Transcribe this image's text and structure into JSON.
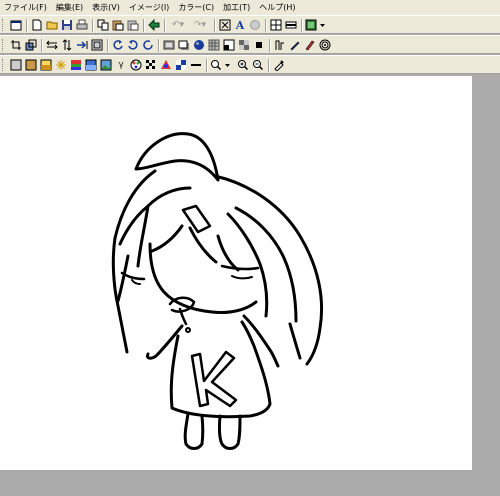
{
  "menu": {
    "items": [
      "ファイル(F)",
      "編集(E)",
      "表示(V)",
      "イメージ(I)",
      "カラー(C)",
      "加工(T)",
      "ヘルプ(H)"
    ]
  },
  "toolbar1": {
    "icons": [
      "new-window-icon",
      "new-file-icon",
      "open-folder-icon",
      "save-icon",
      "print-icon",
      "copy-icon",
      "paste-icon",
      "paste-new-icon",
      "capture-icon",
      "undo-icon",
      "redo-icon",
      "fit-icon",
      "text-icon",
      "circle-icon",
      "grid-icon",
      "ruler-icon",
      "color-select-icon"
    ]
  },
  "toolbar2": {
    "icons": [
      "crop-icon",
      "resize-icon",
      "flip-vertical-icon",
      "flip-horizontal-icon",
      "arrow-right-icon",
      "frame-icon",
      "rotate-left-icon",
      "rotate-right-icon",
      "rotate-icon",
      "emboss-icon",
      "shadow-icon",
      "sphere-icon",
      "pattern-icon",
      "mask-icon",
      "mosaic-icon",
      "black-square-icon",
      "sharpen-icon",
      "pen-icon",
      "brush-icon",
      "spiral-icon"
    ]
  },
  "toolbar3": {
    "icons": [
      "gray-icon",
      "sepia-icon",
      "brightness-icon",
      "sparkle-icon",
      "gradient-icon",
      "color-bars-icon",
      "image-icon",
      "gamma-icon",
      "palette-icon",
      "dither-icon",
      "color-balance-icon",
      "invert-icon",
      "levels-icon",
      "zoom-dropdown-icon",
      "zoom-in-icon",
      "zoom-out-icon",
      "eyedropper-icon"
    ]
  },
  "colors": {
    "menubar_bg": "#ece9d8",
    "workspace_bg": "#ababab",
    "canvas_bg": "#ffffff",
    "ink": "#000000"
  },
  "drawing": {
    "letter": "K"
  }
}
